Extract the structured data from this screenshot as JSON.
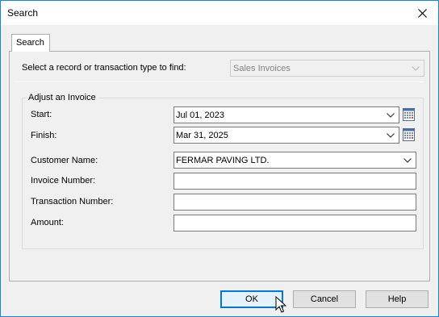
{
  "window": {
    "title": "Search"
  },
  "tabs": [
    {
      "label": "Search"
    }
  ],
  "search": {
    "type_label": "Select a record or transaction type to find:",
    "type_value": "Sales Invoices"
  },
  "group": {
    "title": "Adjust an Invoice",
    "start_label": "Start:",
    "start_value": "Jul 01, 2023",
    "finish_label": "Finish:",
    "finish_value": "Mar 31, 2025",
    "customer_label": "Customer Name:",
    "customer_value": "FERMAR PAVING LTD.",
    "invoice_label": "Invoice Number:",
    "invoice_value": "",
    "transaction_label": "Transaction Number:",
    "transaction_value": "",
    "amount_label": "Amount:",
    "amount_value": ""
  },
  "buttons": {
    "ok": "OK",
    "cancel": "Cancel",
    "help": "Help"
  },
  "icons": {
    "close": "close-icon",
    "dropdown": "chevron-down-icon",
    "calendar": "calendar-icon",
    "pointer": "mouse-pointer-icon"
  },
  "colors": {
    "accent": "#0078d7",
    "border_active": "#1883d7"
  }
}
